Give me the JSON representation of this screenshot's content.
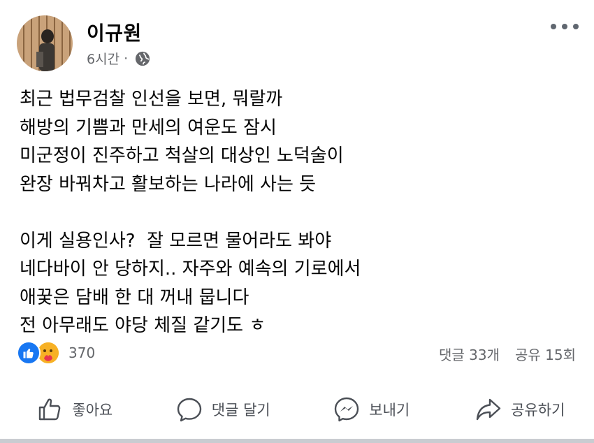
{
  "post": {
    "author": "이규원",
    "time": "6시간",
    "privacy_icon": "globe-icon",
    "lines": [
      "최근 법무검찰 인선을 보면, 뭐랄까",
      "해방의 기쁨과 만세의 여운도 잠시",
      "미군정이 진주하고 척살의 대상인 노덕술이",
      "완장 바꿔차고 활보하는 나라에 사는 듯",
      "",
      "이게 실용인사?  잘 모르면 물어라도 봐야",
      "네다바이 안 당하지.. 자주와 예속의 기로에서",
      "애꿎은 담배 한 대 꺼내 뭅니다",
      "전 아무래도 야당 체질 같기도 ㅎ"
    ]
  },
  "engagement": {
    "reaction_count": "370",
    "comments": "댓글 33개",
    "shares": "공유 15회"
  },
  "actions": {
    "like": "좋아요",
    "comment": "댓글 달기",
    "send": "보내기",
    "share": "공유하기"
  },
  "colors": {
    "like_blue": "#1877f2",
    "care_yellow": "#f7b125",
    "secondary_text": "#65676b"
  }
}
